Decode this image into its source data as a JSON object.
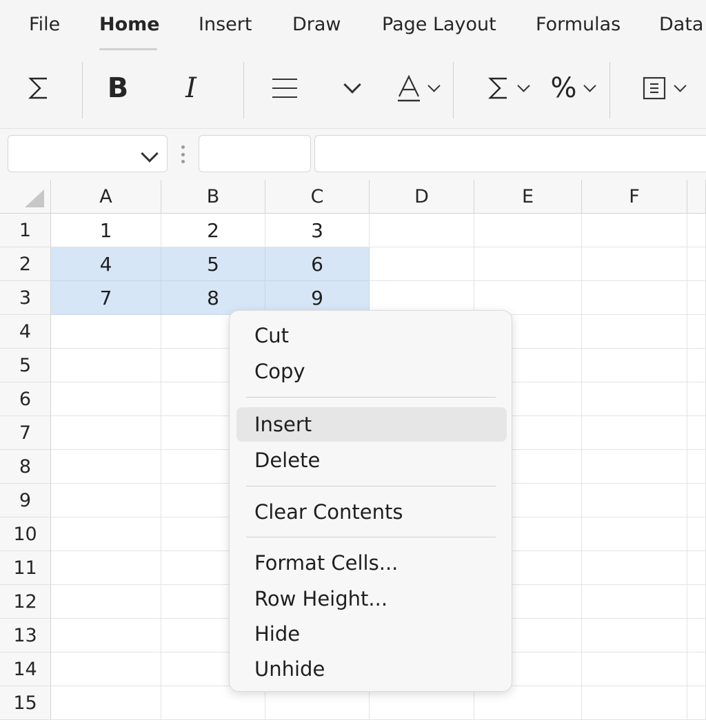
{
  "ribbon": {
    "tabs": [
      {
        "label": "File",
        "active": false
      },
      {
        "label": "Home",
        "active": true
      },
      {
        "label": "Insert",
        "active": false
      },
      {
        "label": "Draw",
        "active": false
      },
      {
        "label": "Page Layout",
        "active": false
      },
      {
        "label": "Formulas",
        "active": false
      },
      {
        "label": "Data",
        "active": false
      }
    ],
    "tools": [
      {
        "name": "autosum-button",
        "icon": "sigma-icon",
        "glyph": "Σ"
      },
      {
        "name": "bold-button",
        "icon": "bold-icon",
        "glyph": "B"
      },
      {
        "name": "italic-button",
        "icon": "italic-icon",
        "glyph": "I"
      },
      {
        "name": "align-button",
        "icon": "align-icon",
        "glyph": "≡"
      },
      {
        "name": "font-color-button",
        "icon": "font-color-icon",
        "glyph": "A"
      },
      {
        "name": "sum-button",
        "icon": "sigma-icon",
        "glyph": "Σ"
      },
      {
        "name": "percent-button",
        "icon": "percent-icon",
        "glyph": "%"
      },
      {
        "name": "format-button",
        "icon": "format-box-icon",
        "glyph": "⊟"
      }
    ]
  },
  "formula_bar": {
    "name_box_value": "",
    "formula_value": ""
  },
  "sheet": {
    "columns": [
      "A",
      "B",
      "C",
      "D",
      "E",
      "F"
    ],
    "rows": [
      "1",
      "2",
      "3",
      "4",
      "5",
      "6",
      "7",
      "8",
      "9",
      "10",
      "11",
      "12",
      "13",
      "14",
      "15"
    ],
    "cells": [
      [
        "1",
        "2",
        "3"
      ],
      [
        "4",
        "5",
        "6"
      ],
      [
        "7",
        "8",
        "9"
      ]
    ],
    "selected_range": "A2:C3",
    "selection_color": "#d7e6f6"
  },
  "context_menu": {
    "groups": [
      [
        {
          "label": "Cut",
          "name": "menu-cut"
        },
        {
          "label": "Copy",
          "name": "menu-copy"
        }
      ],
      [
        {
          "label": "Insert",
          "name": "menu-insert",
          "highlighted": true
        },
        {
          "label": "Delete",
          "name": "menu-delete"
        }
      ],
      [
        {
          "label": "Clear Contents",
          "name": "menu-clear-contents"
        }
      ],
      [
        {
          "label": "Format Cells...",
          "name": "menu-format-cells"
        },
        {
          "label": "Row Height...",
          "name": "menu-row-height"
        },
        {
          "label": "Hide",
          "name": "menu-hide"
        },
        {
          "label": "Unhide",
          "name": "menu-unhide"
        }
      ]
    ]
  }
}
